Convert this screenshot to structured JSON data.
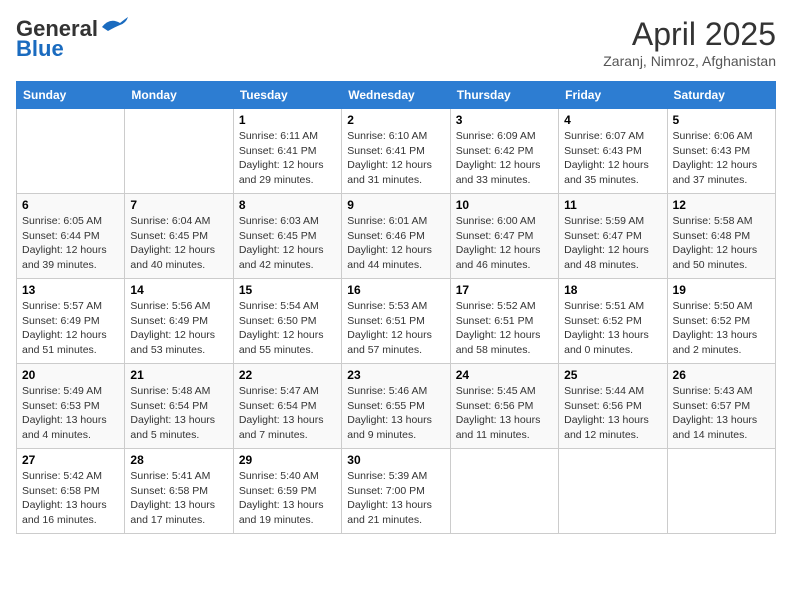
{
  "header": {
    "logo_general": "General",
    "logo_blue": "Blue",
    "title": "April 2025",
    "location": "Zaranj, Nimroz, Afghanistan"
  },
  "days_of_week": [
    "Sunday",
    "Monday",
    "Tuesday",
    "Wednesday",
    "Thursday",
    "Friday",
    "Saturday"
  ],
  "weeks": [
    [
      {
        "day": "",
        "info": ""
      },
      {
        "day": "",
        "info": ""
      },
      {
        "day": "1",
        "info": "Sunrise: 6:11 AM\nSunset: 6:41 PM\nDaylight: 12 hours\nand 29 minutes."
      },
      {
        "day": "2",
        "info": "Sunrise: 6:10 AM\nSunset: 6:41 PM\nDaylight: 12 hours\nand 31 minutes."
      },
      {
        "day": "3",
        "info": "Sunrise: 6:09 AM\nSunset: 6:42 PM\nDaylight: 12 hours\nand 33 minutes."
      },
      {
        "day": "4",
        "info": "Sunrise: 6:07 AM\nSunset: 6:43 PM\nDaylight: 12 hours\nand 35 minutes."
      },
      {
        "day": "5",
        "info": "Sunrise: 6:06 AM\nSunset: 6:43 PM\nDaylight: 12 hours\nand 37 minutes."
      }
    ],
    [
      {
        "day": "6",
        "info": "Sunrise: 6:05 AM\nSunset: 6:44 PM\nDaylight: 12 hours\nand 39 minutes."
      },
      {
        "day": "7",
        "info": "Sunrise: 6:04 AM\nSunset: 6:45 PM\nDaylight: 12 hours\nand 40 minutes."
      },
      {
        "day": "8",
        "info": "Sunrise: 6:03 AM\nSunset: 6:45 PM\nDaylight: 12 hours\nand 42 minutes."
      },
      {
        "day": "9",
        "info": "Sunrise: 6:01 AM\nSunset: 6:46 PM\nDaylight: 12 hours\nand 44 minutes."
      },
      {
        "day": "10",
        "info": "Sunrise: 6:00 AM\nSunset: 6:47 PM\nDaylight: 12 hours\nand 46 minutes."
      },
      {
        "day": "11",
        "info": "Sunrise: 5:59 AM\nSunset: 6:47 PM\nDaylight: 12 hours\nand 48 minutes."
      },
      {
        "day": "12",
        "info": "Sunrise: 5:58 AM\nSunset: 6:48 PM\nDaylight: 12 hours\nand 50 minutes."
      }
    ],
    [
      {
        "day": "13",
        "info": "Sunrise: 5:57 AM\nSunset: 6:49 PM\nDaylight: 12 hours\nand 51 minutes."
      },
      {
        "day": "14",
        "info": "Sunrise: 5:56 AM\nSunset: 6:49 PM\nDaylight: 12 hours\nand 53 minutes."
      },
      {
        "day": "15",
        "info": "Sunrise: 5:54 AM\nSunset: 6:50 PM\nDaylight: 12 hours\nand 55 minutes."
      },
      {
        "day": "16",
        "info": "Sunrise: 5:53 AM\nSunset: 6:51 PM\nDaylight: 12 hours\nand 57 minutes."
      },
      {
        "day": "17",
        "info": "Sunrise: 5:52 AM\nSunset: 6:51 PM\nDaylight: 12 hours\nand 58 minutes."
      },
      {
        "day": "18",
        "info": "Sunrise: 5:51 AM\nSunset: 6:52 PM\nDaylight: 13 hours\nand 0 minutes."
      },
      {
        "day": "19",
        "info": "Sunrise: 5:50 AM\nSunset: 6:52 PM\nDaylight: 13 hours\nand 2 minutes."
      }
    ],
    [
      {
        "day": "20",
        "info": "Sunrise: 5:49 AM\nSunset: 6:53 PM\nDaylight: 13 hours\nand 4 minutes."
      },
      {
        "day": "21",
        "info": "Sunrise: 5:48 AM\nSunset: 6:54 PM\nDaylight: 13 hours\nand 5 minutes."
      },
      {
        "day": "22",
        "info": "Sunrise: 5:47 AM\nSunset: 6:54 PM\nDaylight: 13 hours\nand 7 minutes."
      },
      {
        "day": "23",
        "info": "Sunrise: 5:46 AM\nSunset: 6:55 PM\nDaylight: 13 hours\nand 9 minutes."
      },
      {
        "day": "24",
        "info": "Sunrise: 5:45 AM\nSunset: 6:56 PM\nDaylight: 13 hours\nand 11 minutes."
      },
      {
        "day": "25",
        "info": "Sunrise: 5:44 AM\nSunset: 6:56 PM\nDaylight: 13 hours\nand 12 minutes."
      },
      {
        "day": "26",
        "info": "Sunrise: 5:43 AM\nSunset: 6:57 PM\nDaylight: 13 hours\nand 14 minutes."
      }
    ],
    [
      {
        "day": "27",
        "info": "Sunrise: 5:42 AM\nSunset: 6:58 PM\nDaylight: 13 hours\nand 16 minutes."
      },
      {
        "day": "28",
        "info": "Sunrise: 5:41 AM\nSunset: 6:58 PM\nDaylight: 13 hours\nand 17 minutes."
      },
      {
        "day": "29",
        "info": "Sunrise: 5:40 AM\nSunset: 6:59 PM\nDaylight: 13 hours\nand 19 minutes."
      },
      {
        "day": "30",
        "info": "Sunrise: 5:39 AM\nSunset: 7:00 PM\nDaylight: 13 hours\nand 21 minutes."
      },
      {
        "day": "",
        "info": ""
      },
      {
        "day": "",
        "info": ""
      },
      {
        "day": "",
        "info": ""
      }
    ]
  ]
}
